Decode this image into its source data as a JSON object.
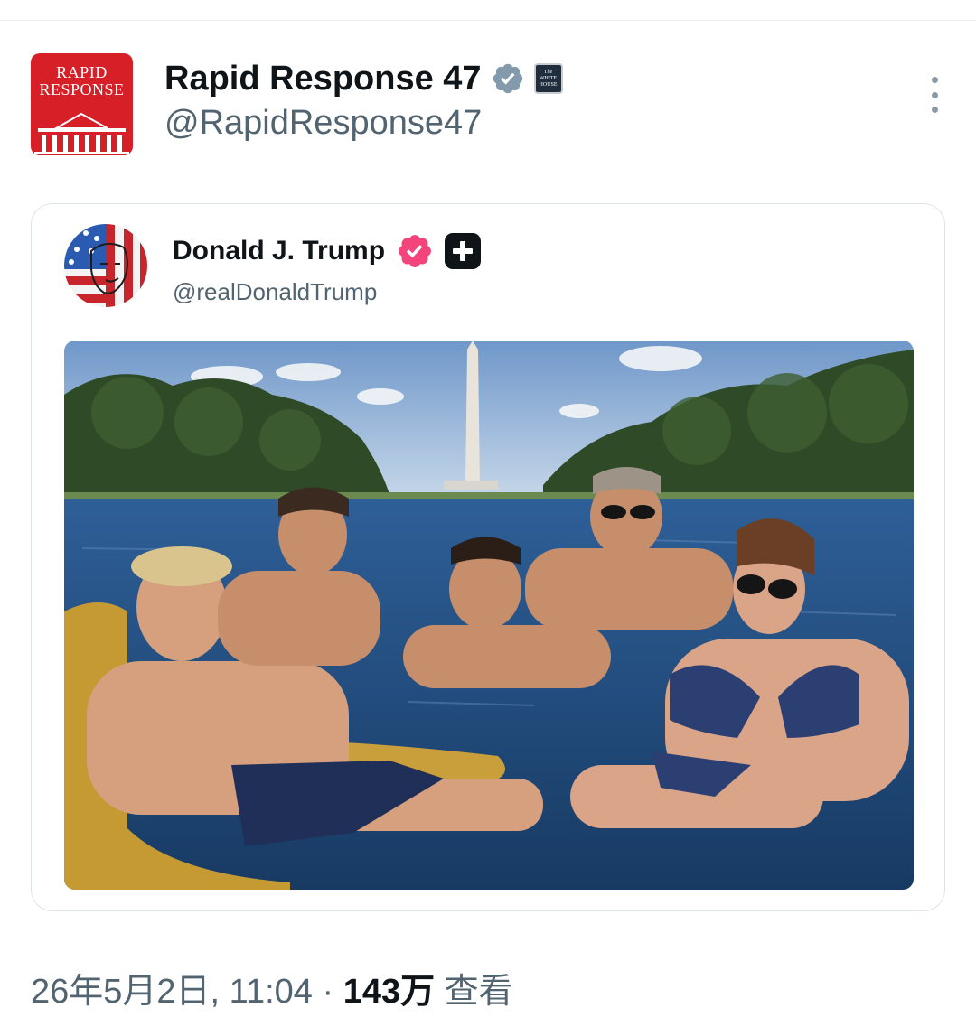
{
  "post": {
    "author": {
      "display_name": "Rapid Response 47",
      "handle": "@RapidResponse47",
      "avatar_text": [
        "RAPID",
        "RESPONSE"
      ],
      "verified_icon": "verified-badge-icon",
      "affiliation_badge_text": "The WHITE HOUSE"
    },
    "more_icon": "more-vertical-icon",
    "quote": {
      "display_name": "Donald J. Trump",
      "handle": "@realDonaldTrump",
      "verified_icon": "verified-badge-pink-icon",
      "affiliation_icon": "plus-icon"
    },
    "meta": {
      "datetime": "26年5月2日, 11:04",
      "separator": " · ",
      "views_count": "143万",
      "views_label": " 查看"
    }
  },
  "colors": {
    "text_primary": "#0f1419",
    "text_secondary": "#536471",
    "verified_gray": "#829aab",
    "verified_pink": "#f4447c",
    "rr_red": "#d61f26"
  }
}
